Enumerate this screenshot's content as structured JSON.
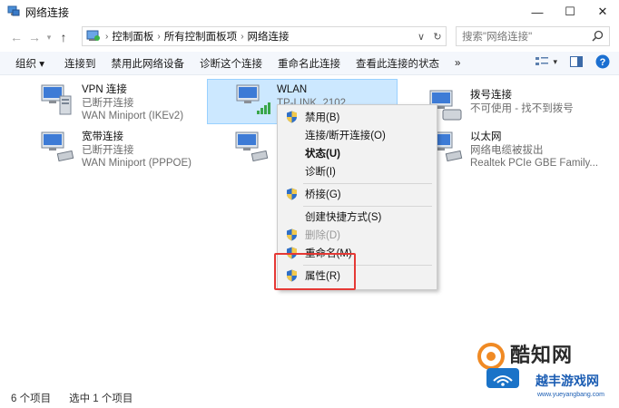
{
  "window": {
    "title": "网络连接",
    "minimize": "—",
    "maximize": "☐",
    "close": "✕"
  },
  "address": {
    "crumbs": [
      "控制面板",
      "所有控制面板项",
      "网络连接"
    ],
    "search_placeholder": "搜索\"网络连接\""
  },
  "toolbar": {
    "organize": "组织 ▾",
    "connect_to": "连接到",
    "disable_device": "禁用此网络设备",
    "diagnose": "诊断这个连接",
    "rename": "重命名此连接",
    "view_status": "查看此连接的状态",
    "more": "»"
  },
  "connections": [
    {
      "name": "VPN 连接",
      "status": "已断开连接",
      "device": "WAN Miniport (IKEv2)"
    },
    {
      "name": "宽带连接",
      "status": "已断开连接",
      "device": "WAN Miniport (PPPOE)"
    },
    {
      "name": "WLAN",
      "status": "TP-LINK_2102",
      "device": ""
    },
    {
      "name": "拨号连接",
      "status": "不可使用 - 找不到拨号",
      "device": ""
    },
    {
      "name": "以太网",
      "status": "网络电缆被拔出",
      "device": "Realtek PCIe GBE Family..."
    }
  ],
  "context_menu": [
    {
      "label": "禁用(B)"
    },
    {
      "label": "连接/断开连接(O)"
    },
    {
      "label": "状态(U)"
    },
    {
      "label": "诊断(I)"
    },
    {
      "label": "桥接(G)"
    },
    {
      "label": "创建快捷方式(S)"
    },
    {
      "label": "删除(D)"
    },
    {
      "label": "重命名(M)"
    },
    {
      "label": "属性(R)"
    }
  ],
  "status_bar": {
    "item_count": "6 个项目",
    "selected_count": "选中 1 个项目"
  },
  "watermark": {
    "brand": "酷知网",
    "site_name": "越丰游戏网",
    "site_url": "www.yueyangbang.com"
  },
  "colors": {
    "accent_blue": "#1b6fd1",
    "selection_bg": "#cce8ff",
    "highlight_red": "#e53935"
  }
}
